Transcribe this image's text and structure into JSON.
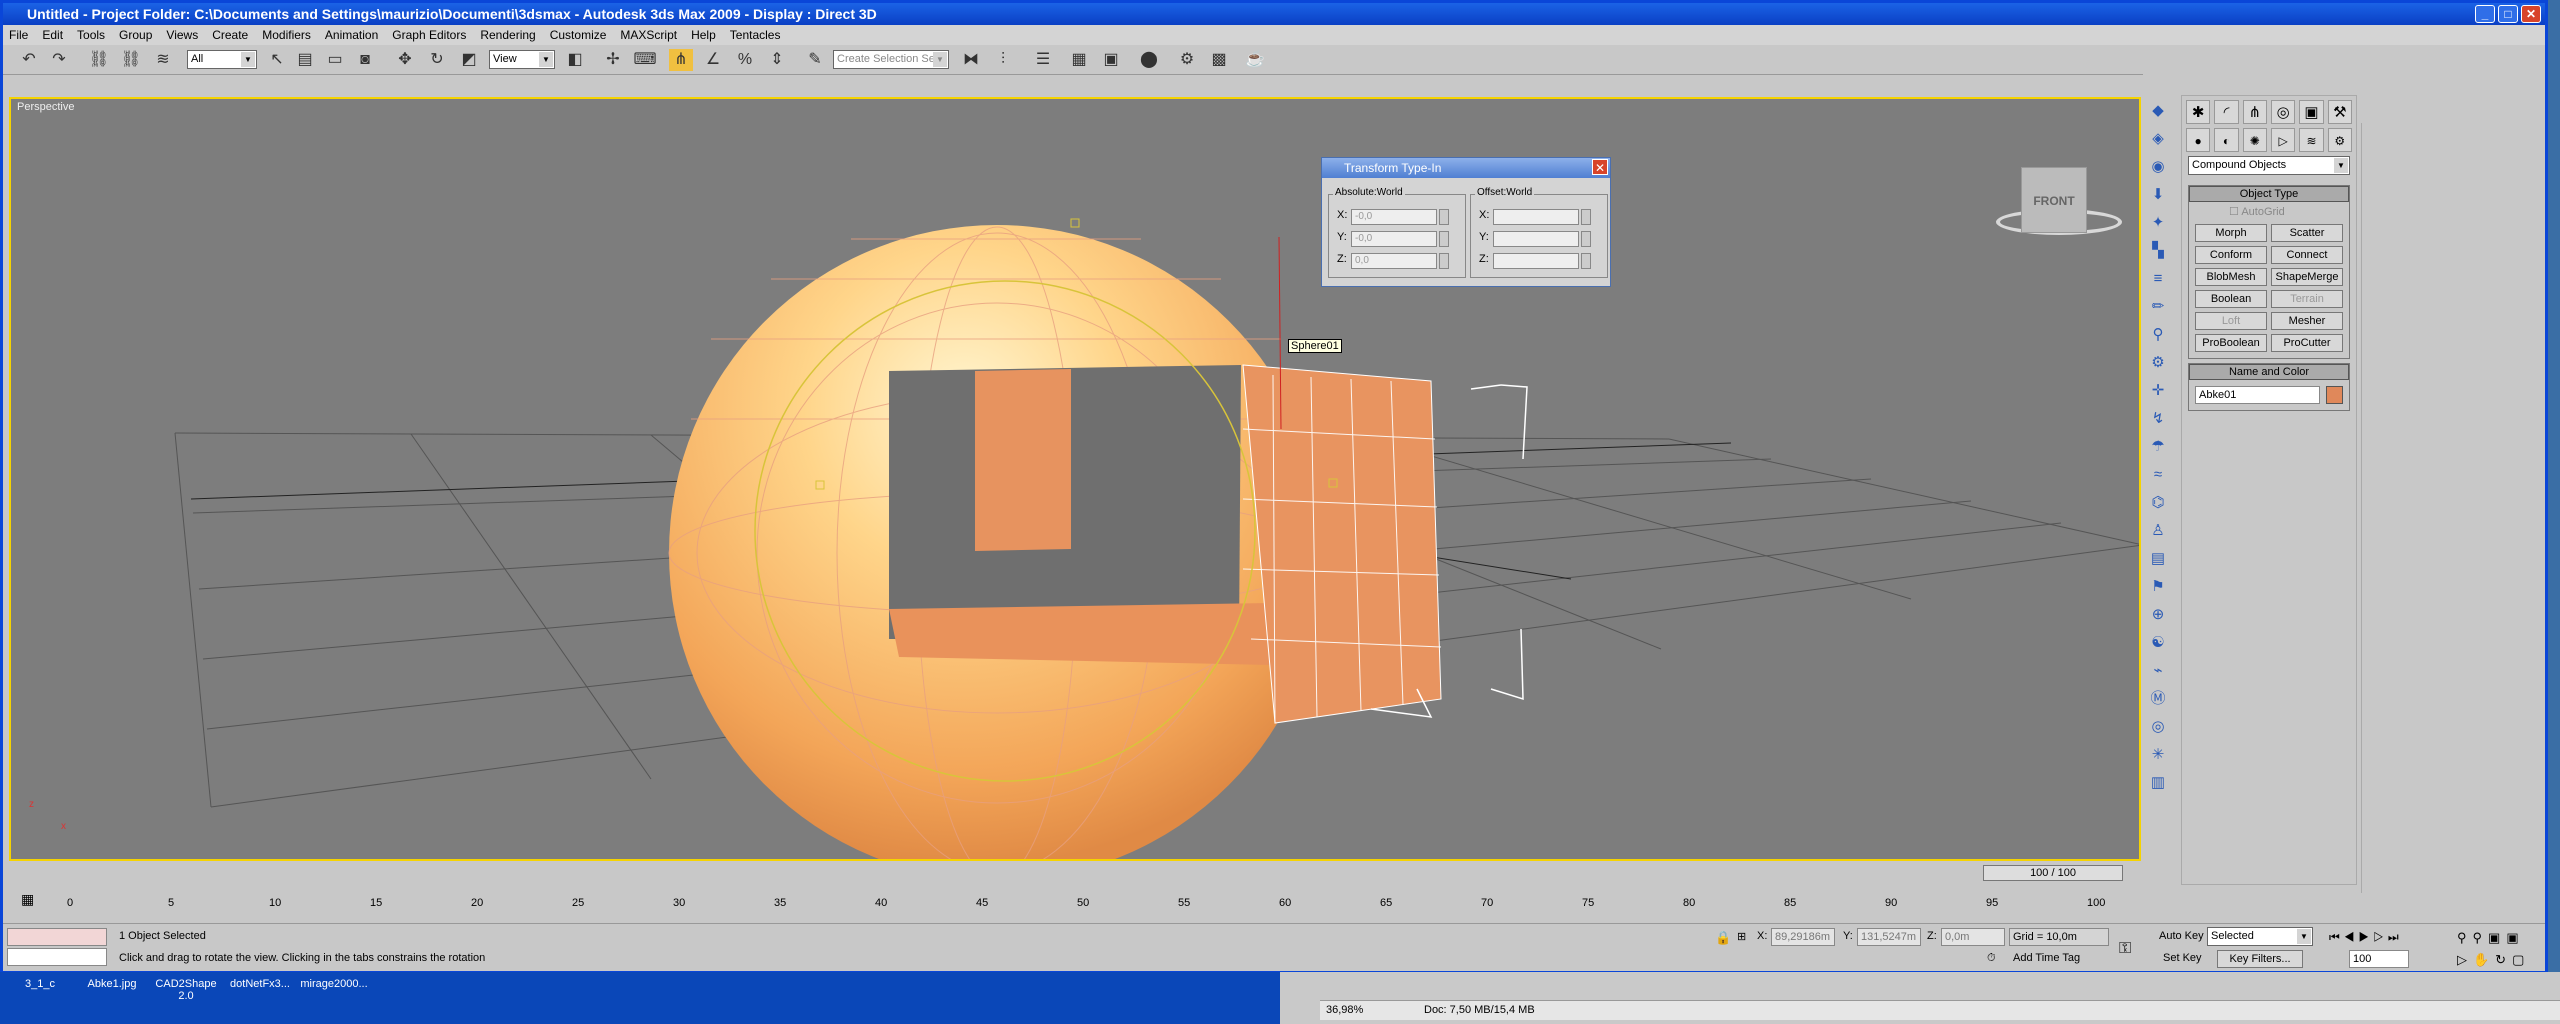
{
  "window": {
    "title": "Untitled      - Project Folder: C:\\Documents and Settings\\maurizio\\Documenti\\3dsmax      - Autodesk 3ds Max  2009      - Display : Direct 3D",
    "btn_min": "_",
    "btn_max": "□",
    "btn_close": "✕"
  },
  "menu": [
    "File",
    "Edit",
    "Tools",
    "Group",
    "Views",
    "Create",
    "Modifiers",
    "Animation",
    "Graph Editors",
    "Rendering",
    "Customize",
    "MAXScript",
    "Help",
    "Tentacles"
  ],
  "toolbar": {
    "filter": "All",
    "coord": "View",
    "named_sel_placeholder": "Create Selection Set"
  },
  "viewport": {
    "label": "Perspective",
    "nav_cube": "FRONT",
    "tooltip": "Sphere01",
    "axis_z": "z",
    "axis_x": "x"
  },
  "tti": {
    "title": "Transform Type-In",
    "abs_label": "Absolute:World",
    "off_label": "Offset:World",
    "x_label": "X:",
    "y_label": "Y:",
    "z_label": "Z:",
    "x_val": "-0,0",
    "y_val": "-0,0",
    "z_val": "0,0"
  },
  "cmd": {
    "category": "Compound Objects",
    "objtype_head": "Object Type",
    "autogrid": "AutoGrid",
    "buttons": [
      "Morph",
      "Scatter",
      "Conform",
      "Connect",
      "BlobMesh",
      "ShapeMerge",
      "Boolean",
      "Terrain",
      "Loft",
      "Mesher",
      "ProBoolean",
      "ProCutter"
    ],
    "disabled": [
      "Terrain",
      "Loft"
    ],
    "namecolor_head": "Name and Color",
    "name": "Abke01",
    "obj_color": "#e0885a"
  },
  "timeline": {
    "slider": "100 / 100",
    "ticks": [
      "0",
      "5",
      "10",
      "15",
      "20",
      "25",
      "30",
      "35",
      "40",
      "45",
      "50",
      "55",
      "60",
      "65",
      "70",
      "75",
      "80",
      "85",
      "90",
      "95",
      "100"
    ]
  },
  "status": {
    "selected": "1 Object Selected",
    "prompt": "Click and drag to rotate the view.  Clicking in the tabs constrains the rotation",
    "x_label": "X:",
    "x": "89,29186m",
    "y_label": "Y:",
    "y": "131,5247m",
    "z_label": "Z:",
    "z": "0,0m",
    "grid": "Grid = 10,0m",
    "add_time_tag": "Add Time Tag",
    "auto_key": "Auto Key",
    "key_sel": "Selected",
    "set_key": "Set Key",
    "key_filters": "Key Filters...",
    "frame": "100"
  },
  "desktop": {
    "icons": [
      "3_1_c",
      "Abke1.jpg",
      "CAD2Shape\n2.0",
      "dotNetFx3...",
      "mirage2000..."
    ]
  },
  "bg_window": {
    "zoom": "36,98%",
    "doc": "Doc: 7,50 MB/15,4 MB"
  }
}
